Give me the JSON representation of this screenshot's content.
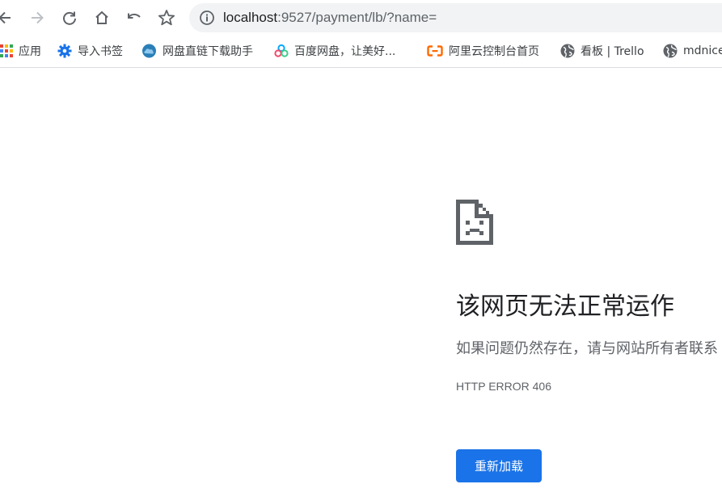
{
  "address_bar": {
    "url_host": "localhost",
    "url_rest": ":9527/payment/lb/?name="
  },
  "nav_icons": {
    "back": "back-arrow-icon",
    "forward": "forward-arrow-icon",
    "reload": "reload-icon",
    "home": "home-icon",
    "undo": "undo-icon",
    "bookmark": "star-icon",
    "site_info": "info-icon"
  },
  "bookmarks": [
    {
      "label": "应用",
      "icon": "apps-grid-icon"
    },
    {
      "label": "导入书签",
      "icon": "gear-icon"
    },
    {
      "label": "网盘直链下载助手",
      "icon": "cloud-icon"
    },
    {
      "label": "百度网盘，让美好...",
      "icon": "baidu-netdisk-icon"
    },
    {
      "label": "阿里云控制台首页",
      "icon": "aliyun-icon"
    },
    {
      "label": "看板 | Trello",
      "icon": "globe-icon"
    },
    {
      "label": "mdnice",
      "icon": "globe-icon"
    }
  ],
  "error_page": {
    "icon": "sad-page-icon",
    "title": "该网页无法正常运作",
    "subtitle": "如果问题仍然存在，请与网站所有者联系",
    "error_code": "HTTP ERROR 406",
    "reload_label": "重新加载"
  },
  "colors": {
    "accent": "#1a73e8",
    "omnibox_bg": "#f1f3f4",
    "title_text": "#202124",
    "secondary_text": "#5f6368"
  }
}
